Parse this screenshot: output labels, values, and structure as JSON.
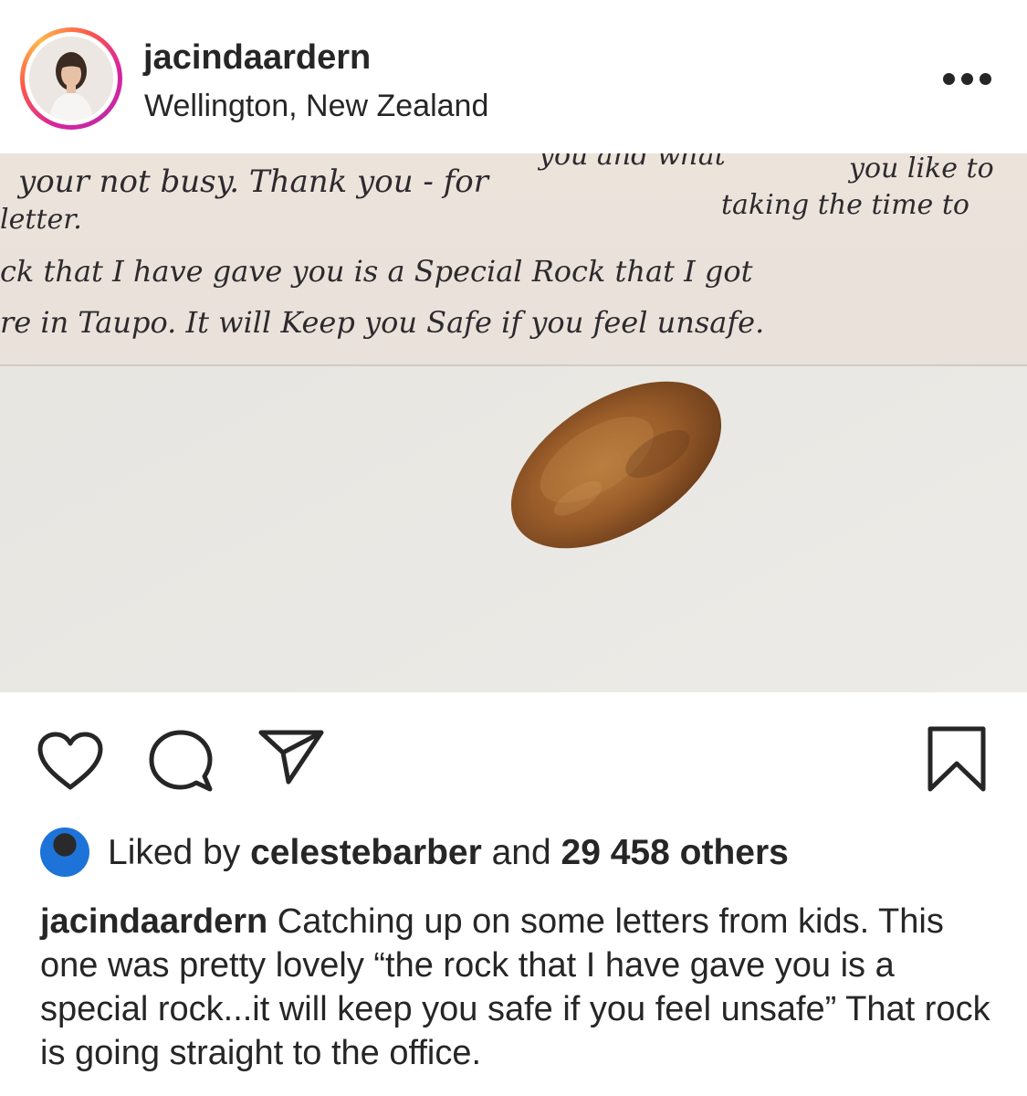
{
  "post": {
    "username": "jacindaardern",
    "location": "Wellington, New Zealand",
    "more_icon": "more-horizontal-icon"
  },
  "photo": {
    "handwriting": {
      "line0": "you and what",
      "line1a": "your not busy. Thank you - for",
      "line1b": "taking the time to",
      "line1c": "you like to",
      "line2": "letter.",
      "line3a": "ck that I have gave you is a Special Rock that I got",
      "line4a": "re in Taupo. It will Keep you Safe if you feel unsafe."
    }
  },
  "actions": {
    "like_icon": "heart-icon",
    "comment_icon": "comment-icon",
    "share_icon": "send-icon",
    "save_icon": "bookmark-icon"
  },
  "likes": {
    "prefix": "Liked by",
    "user": "celestebarber",
    "middle": "and",
    "count": "29 458 others"
  },
  "caption": {
    "author": "jacindaardern",
    "text": "Catching up on some letters from kids. This one was pretty lovely “the rock that I have gave you is a special rock...it will keep you safe if you feel unsafe” That rock is going straight to the office."
  }
}
